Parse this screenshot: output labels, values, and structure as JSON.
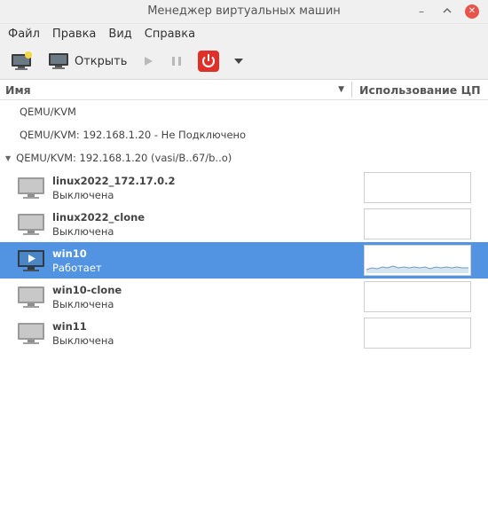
{
  "window": {
    "title": "Менеджер виртуальных машин"
  },
  "menu": [
    "Файл",
    "Правка",
    "Вид",
    "Справка"
  ],
  "toolbar": {
    "new_vm": "new-vm-icon",
    "open_label": "Открыть",
    "run": "play-icon",
    "pause": "pause-icon",
    "shutdown": "power-icon",
    "accent_power": "#e0302a"
  },
  "columns": {
    "name": "Имя",
    "cpu": "Использование ЦП"
  },
  "connections": [
    {
      "label": "QEMU/KVM"
    },
    {
      "label": "QEMU/KVM: 192.168.1.20 - Не Подключено"
    },
    {
      "label": "QEMU/KVM: 192.168.1.20 (vasi/B..67/b..o)"
    }
  ],
  "vms": [
    {
      "name": "linux2022_172.17.0.2",
      "status": "Выключена"
    },
    {
      "name": "linux2022_clone",
      "status": "Выключена"
    },
    {
      "name": "win10",
      "status": "Работает"
    },
    {
      "name": "win10-clone",
      "status": "Выключена"
    },
    {
      "name": "win11",
      "status": "Выключена"
    }
  ],
  "selection_color": "#5294e2"
}
